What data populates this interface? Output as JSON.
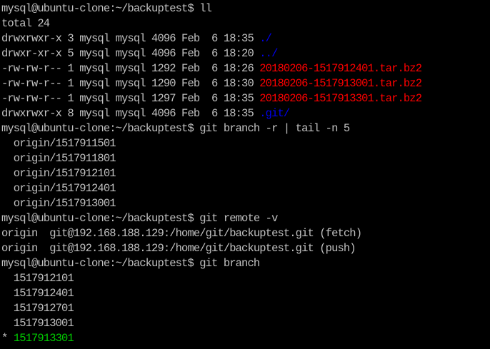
{
  "terminal": {
    "colors": {
      "background": "#000000",
      "default": "#c0c0c0",
      "blue": "#0000ee",
      "red": "#ff0000",
      "green": "#00cd00"
    },
    "lines": [
      [
        {
          "text": "mysql@ubuntu-clone:~/backuptest$ ll",
          "color": "default"
        }
      ],
      [
        {
          "text": "total 24",
          "color": "default"
        }
      ],
      [
        {
          "text": "drwxrwxr-x 3 mysql mysql 4096 Feb  6 18:35 ",
          "color": "default"
        },
        {
          "text": "./",
          "color": "blue"
        }
      ],
      [
        {
          "text": "drwxr-xr-x 5 mysql mysql 4096 Feb  6 18:20 ",
          "color": "default"
        },
        {
          "text": "../",
          "color": "blue"
        }
      ],
      [
        {
          "text": "-rw-rw-r-- 1 mysql mysql 1292 Feb  6 18:26 ",
          "color": "default"
        },
        {
          "text": "20180206-1517912401.tar.bz2",
          "color": "red"
        }
      ],
      [
        {
          "text": "-rw-rw-r-- 1 mysql mysql 1290 Feb  6 18:30 ",
          "color": "default"
        },
        {
          "text": "20180206-1517913001.tar.bz2",
          "color": "red"
        }
      ],
      [
        {
          "text": "-rw-rw-r-- 1 mysql mysql 1297 Feb  6 18:35 ",
          "color": "default"
        },
        {
          "text": "20180206-1517913301.tar.bz2",
          "color": "red"
        }
      ],
      [
        {
          "text": "drwxrwxr-x 8 mysql mysql 4096 Feb  6 18:35 ",
          "color": "default"
        },
        {
          "text": ".git/",
          "color": "blue"
        }
      ],
      [
        {
          "text": "mysql@ubuntu-clone:~/backuptest$ git branch -r | tail -n 5",
          "color": "default"
        }
      ],
      [
        {
          "text": "  origin/1517911501",
          "color": "default"
        }
      ],
      [
        {
          "text": "  origin/1517911801",
          "color": "default"
        }
      ],
      [
        {
          "text": "  origin/1517912101",
          "color": "default"
        }
      ],
      [
        {
          "text": "  origin/1517912401",
          "color": "default"
        }
      ],
      [
        {
          "text": "  origin/1517913001",
          "color": "default"
        }
      ],
      [
        {
          "text": "mysql@ubuntu-clone:~/backuptest$ git remote -v",
          "color": "default"
        }
      ],
      [
        {
          "text": "origin  git@192.168.188.129:/home/git/backuptest.git (fetch)",
          "color": "default"
        }
      ],
      [
        {
          "text": "origin  git@192.168.188.129:/home/git/backuptest.git (push)",
          "color": "default"
        }
      ],
      [
        {
          "text": "mysql@ubuntu-clone:~/backuptest$ git branch",
          "color": "default"
        }
      ],
      [
        {
          "text": "  1517912101",
          "color": "default"
        }
      ],
      [
        {
          "text": "  1517912401",
          "color": "default"
        }
      ],
      [
        {
          "text": "  1517912701",
          "color": "default"
        }
      ],
      [
        {
          "text": "  1517913001",
          "color": "default"
        }
      ],
      [
        {
          "text": "* ",
          "color": "default"
        },
        {
          "text": "1517913301",
          "color": "green"
        }
      ]
    ]
  }
}
